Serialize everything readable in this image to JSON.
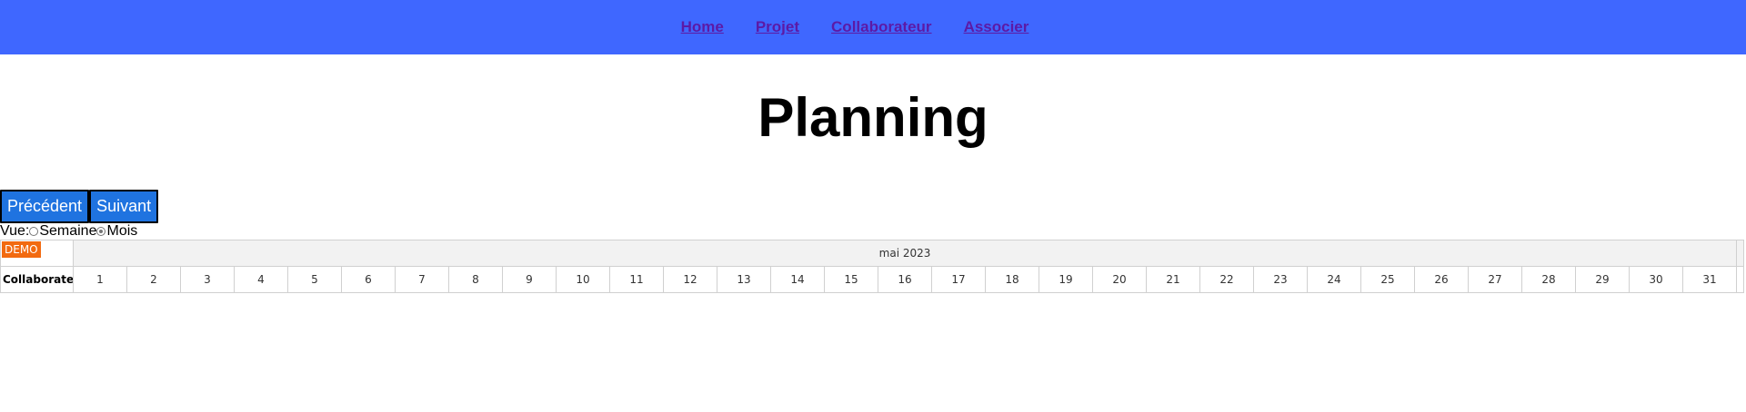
{
  "nav": {
    "links": [
      "Home",
      "Projet",
      "Collaborateur",
      "Associer"
    ]
  },
  "page": {
    "title": "Planning"
  },
  "controls": {
    "prev_label": "Précédent",
    "next_label": "Suivant",
    "view_label": "Vue:",
    "view_options": [
      "Semaine",
      "Mois"
    ],
    "view_selected": "Mois"
  },
  "scheduler": {
    "badge": "DEMO",
    "month": "mai 2023",
    "row_header": "Collaborateur",
    "days": [
      "1",
      "2",
      "3",
      "4",
      "5",
      "6",
      "7",
      "8",
      "9",
      "10",
      "11",
      "12",
      "13",
      "14",
      "15",
      "16",
      "17",
      "18",
      "19",
      "20",
      "21",
      "22",
      "23",
      "24",
      "25",
      "26",
      "27",
      "28",
      "29",
      "30",
      "31"
    ]
  },
  "colors": {
    "navbar": "#3f67ff",
    "link": "#5c1aa6",
    "button": "#1f73e0",
    "badge": "#f26a10"
  }
}
